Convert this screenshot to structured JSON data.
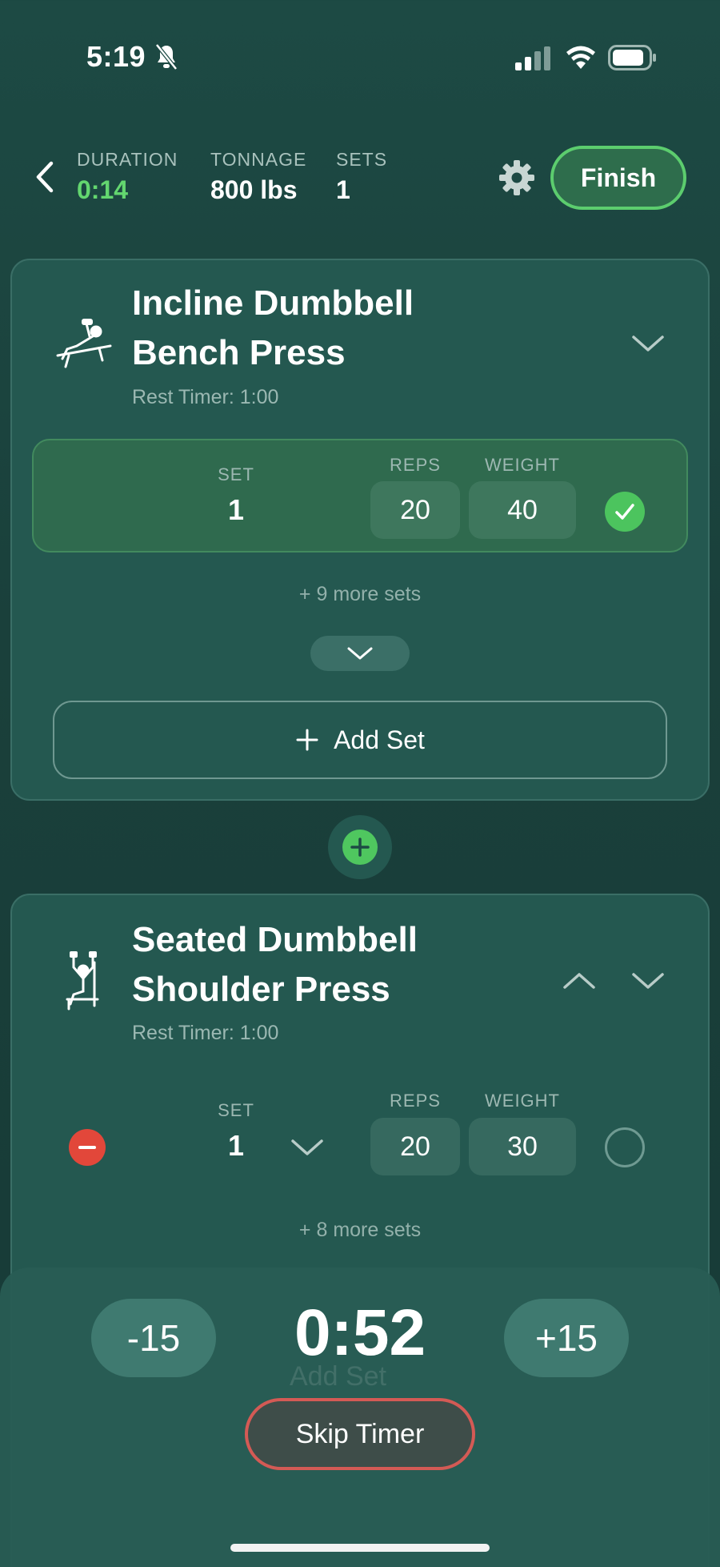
{
  "status_bar": {
    "time": "5:19"
  },
  "header": {
    "duration_label": "DURATION",
    "duration_value": "0:14",
    "tonnage_label": "TONNAGE",
    "tonnage_value": "800 lbs",
    "sets_label": "SETS",
    "sets_value": "1",
    "finish_label": "Finish"
  },
  "exercises": [
    {
      "title_line1": "Incline Dumbbell",
      "title_line2": "Bench Press",
      "rest_timer": "Rest Timer: 1:00",
      "set_label": "SET",
      "reps_label": "REPS",
      "weight_label": "WEIGHT",
      "set_number": "1",
      "reps": "20",
      "weight": "40",
      "completed": true,
      "more_sets": "+ 9 more sets",
      "add_set_label": "Add Set"
    },
    {
      "title_line1": "Seated Dumbbell",
      "title_line2": "Shoulder Press",
      "rest_timer": "Rest Timer: 1:00",
      "set_label": "SET",
      "reps_label": "REPS",
      "weight_label": "WEIGHT",
      "set_number": "1",
      "reps": "20",
      "weight": "30",
      "completed": false,
      "more_sets": "+ 8 more sets",
      "add_set_label": "Add Set"
    }
  ],
  "rest_timer": {
    "minus_label": "-15",
    "value": "0:52",
    "plus_label": "+15",
    "skip_label": "Skip Timer"
  },
  "colors": {
    "accent_green": "#63d66f",
    "card_bg": "#245850",
    "remove_red": "#e2473a",
    "skip_border": "#d45a55"
  },
  "icons": [
    "bell-slash-icon",
    "signal-icon",
    "wifi-icon",
    "battery-icon",
    "back-chevron-icon",
    "gear-icon",
    "chevron-down-icon",
    "chevron-up-icon",
    "checkmark-icon",
    "plus-icon",
    "minus-icon"
  ]
}
